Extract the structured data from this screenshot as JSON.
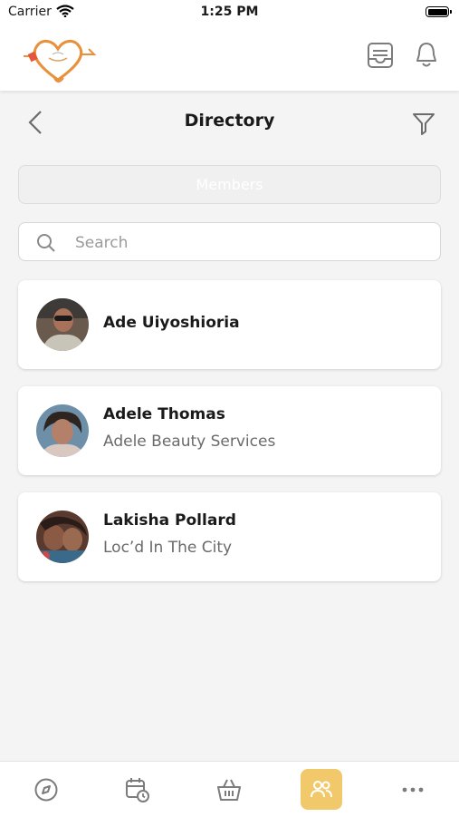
{
  "status_bar": {
    "carrier": "Carrier",
    "time": "1:25 PM"
  },
  "header": {
    "logo": "heart-logo",
    "icons": [
      "inbox-icon",
      "bell-icon"
    ]
  },
  "page": {
    "title": "Directory",
    "back_icon": "chevron-left-icon",
    "filter_icon": "filter-icon"
  },
  "members_field": {
    "label": "Members"
  },
  "search": {
    "placeholder": "Search",
    "value": ""
  },
  "members": [
    {
      "name": "Ade Uiyoshioria",
      "business": ""
    },
    {
      "name": "Adele Thomas",
      "business": "Adele Beauty Services"
    },
    {
      "name": "Lakisha Pollard",
      "business": "Loc’d In The City"
    }
  ],
  "bottom_nav": {
    "items": [
      "compass-icon",
      "calendar-clock-icon",
      "basket-icon",
      "people-icon",
      "more-icon"
    ],
    "active": "people-icon",
    "active_color": "#f2c96a"
  }
}
